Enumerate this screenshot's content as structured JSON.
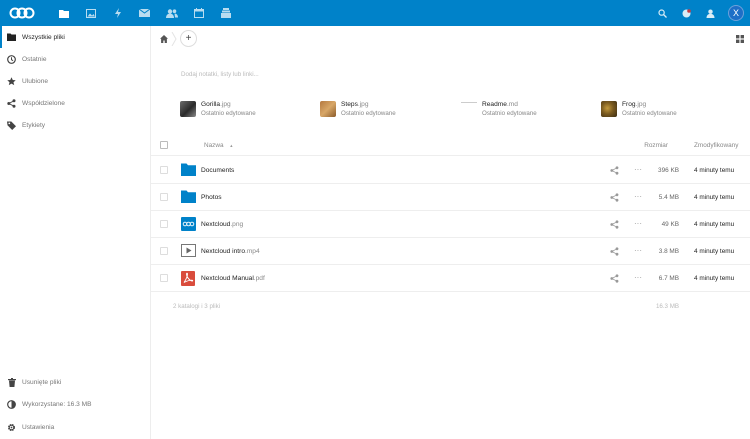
{
  "header": {
    "avatar_initial": "X",
    "brand_color": "#0082c9",
    "app_icons": [
      "files-icon",
      "photos-icon",
      "activity-icon",
      "mail-icon",
      "contacts-icon",
      "calendar-icon",
      "deck-icon"
    ],
    "right_icons": [
      "search-icon",
      "notifications-icon",
      "contacts-menu-icon"
    ]
  },
  "sidebar": {
    "items": [
      {
        "label": "Wszystkie pliki",
        "icon": "folder-icon"
      },
      {
        "label": "Ostatnie",
        "icon": "clock-icon"
      },
      {
        "label": "Ulubione",
        "icon": "star-icon"
      },
      {
        "label": "Współdzielone",
        "icon": "share-icon"
      },
      {
        "label": "Etykiety",
        "icon": "tag-icon"
      }
    ],
    "bottom": [
      {
        "label": "Usunięte pliki",
        "icon": "trash-icon"
      },
      {
        "label": "Wykorzystane: 16.3 MB",
        "icon": "pie-icon"
      },
      {
        "label": "Ustawienia",
        "icon": "gear-icon"
      }
    ]
  },
  "main": {
    "add_label": "+",
    "notes_placeholder": "Dodaj notatki, listy lub linki...",
    "recent": [
      {
        "name": "Gorilla",
        "ext": ".jpg",
        "sub": "Ostatnio edytowane"
      },
      {
        "name": "Steps",
        "ext": ".jpg",
        "sub": "Ostatnio edytowane"
      },
      {
        "name": "Readme",
        "ext": ".md",
        "sub": "Ostatnio edytowane"
      },
      {
        "name": "Frog",
        "ext": ".jpg",
        "sub": "Ostatnio edytowane"
      }
    ],
    "columns": {
      "name": "Nazwa",
      "sort_indicator": "▲",
      "size": "Rozmiar",
      "modified": "Zmodyfikowany"
    },
    "files": [
      {
        "name": "Documents",
        "ext": "",
        "size": "396 KB",
        "modified": "4 minuty temu",
        "type": "folder"
      },
      {
        "name": "Photos",
        "ext": "",
        "size": "5.4 MB",
        "modified": "4 minuty temu",
        "type": "folder"
      },
      {
        "name": "Nextcloud",
        "ext": ".png",
        "size": "49 KB",
        "modified": "4 minuty temu",
        "type": "image"
      },
      {
        "name": "Nextcloud intro",
        "ext": ".mp4",
        "size": "3.8 MB",
        "modified": "4 minuty temu",
        "type": "video"
      },
      {
        "name": "Nextcloud Manual",
        "ext": ".pdf",
        "size": "6.7 MB",
        "modified": "4 minuty temu",
        "type": "pdf"
      }
    ],
    "summary": "2 katalogi i 3 pliki",
    "summary_size": "16.3 MB",
    "more_glyph": "···"
  }
}
